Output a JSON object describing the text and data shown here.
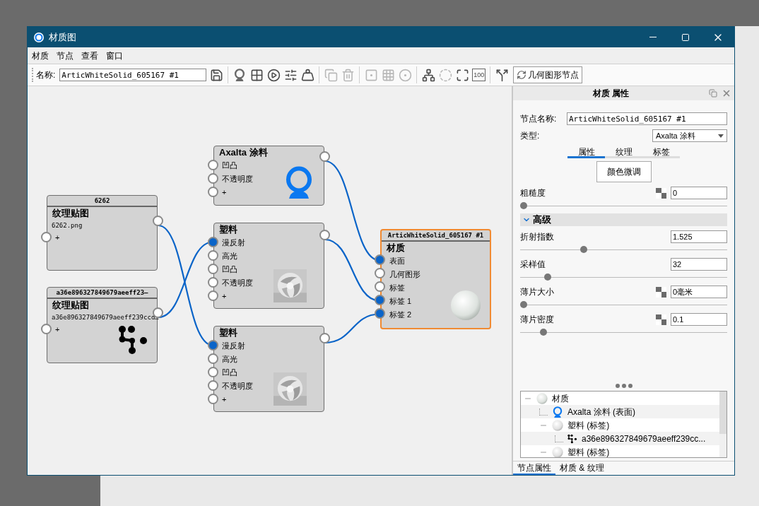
{
  "window": {
    "title": "材质图"
  },
  "menu": [
    "材质",
    "节点",
    "查看",
    "窗口"
  ],
  "toolbar": {
    "name_label": "名称:",
    "name_value": "ArticWhiteSolid_605167 #1",
    "tools": [
      {
        "kind": "save",
        "disabled": false
      },
      {
        "kind": "ring",
        "disabled": false
      },
      {
        "kind": "checker",
        "disabled": false
      },
      {
        "kind": "play",
        "disabled": false
      },
      {
        "kind": "sliders",
        "disabled": false
      },
      {
        "kind": "weight",
        "disabled": false
      },
      {
        "kind": "copy",
        "disabled": true
      },
      {
        "kind": "trash",
        "disabled": true
      },
      {
        "kind": "square-dot",
        "disabled": true
      },
      {
        "kind": "grid-dot",
        "disabled": true
      },
      {
        "kind": "dots-dot",
        "disabled": true
      },
      {
        "kind": "hierarchy",
        "disabled": false
      },
      {
        "kind": "dashed",
        "disabled": true
      },
      {
        "kind": "fit",
        "disabled": false
      },
      {
        "kind": "hundred",
        "label": "100",
        "disabled": false
      },
      {
        "kind": "merge",
        "disabled": false
      }
    ],
    "geometry_button": "几何图形节点"
  },
  "nodes": [
    {
      "header": "6262",
      "title": "纹理贴图",
      "subtitle": "6262.png",
      "output": true,
      "selected": false,
      "ports": [
        {
          "label": "+",
          "connected": false
        }
      ]
    },
    {
      "header": "a36e896327849679aeeff23—",
      "title": "纹理贴图",
      "subtitle": "a36e896327849679aeeff239ccd…",
      "output": true,
      "selected": false,
      "ports": [
        {
          "label": "+",
          "connected": false
        }
      ]
    },
    {
      "title": "Axalta 涂料",
      "output": true,
      "selected": false,
      "ports": [
        {
          "label": "凹凸",
          "connected": false
        },
        {
          "label": "不透明度",
          "connected": false
        },
        {
          "label": "+",
          "connected": false
        }
      ]
    },
    {
      "title": "塑料",
      "output": true,
      "selected": false,
      "ports": [
        {
          "label": "漫反射",
          "connected": true
        },
        {
          "label": "高光",
          "connected": false
        },
        {
          "label": "凹凸",
          "connected": false
        },
        {
          "label": "不透明度",
          "connected": false
        },
        {
          "label": "+",
          "connected": false
        }
      ]
    },
    {
      "title": "塑料",
      "output": true,
      "selected": false,
      "ports": [
        {
          "label": "漫反射",
          "connected": true
        },
        {
          "label": "高光",
          "connected": false
        },
        {
          "label": "凹凸",
          "connected": false
        },
        {
          "label": "不透明度",
          "connected": false
        },
        {
          "label": "+",
          "connected": false
        }
      ]
    },
    {
      "header": "ArticWhiteSolid_605167 #1",
      "title": "材质",
      "output": false,
      "selected": true,
      "ports": [
        {
          "label": "表面",
          "connected": true
        },
        {
          "label": "几何图形",
          "connected": false
        },
        {
          "label": "标签",
          "connected": false
        },
        {
          "label": "标签 1",
          "connected": true
        },
        {
          "label": "标签 2",
          "connected": true
        }
      ]
    }
  ],
  "panel": {
    "title": "材质 属性",
    "node_name_label": "节点名称:",
    "node_name": "ArticWhiteSolid_605167 #1",
    "type_label": "类型:",
    "type_value": "Axalta 涂料",
    "tabs": [
      {
        "label": "属性",
        "selected": true
      },
      {
        "label": "纹理",
        "selected": false
      },
      {
        "label": "标签",
        "selected": false
      }
    ],
    "tune_button": "颜色微调",
    "properties": [
      {
        "kind": "slider",
        "label": "粗糙度",
        "value": "0",
        "texture": true,
        "level": 0
      },
      {
        "kind": "section",
        "label": "高级",
        "expanded": true
      },
      {
        "kind": "slider",
        "label": "折射指数",
        "value": "1.525",
        "texture": false,
        "level": 0.3
      },
      {
        "kind": "slider",
        "label": "采样值",
        "value": "32",
        "texture": false,
        "level": 0.12
      },
      {
        "kind": "slider",
        "label": "薄片大小",
        "value": "0毫米",
        "texture": true,
        "level": 0
      },
      {
        "kind": "slider",
        "label": "薄片密度",
        "value": "0.1",
        "texture": true,
        "level": 0.1
      }
    ],
    "tree": [
      {
        "label": "材质",
        "kind": "material",
        "expanded": true,
        "children": [
          {
            "label": "Axalta 涂料 (表面)",
            "kind": "paint",
            "expanded": false
          },
          {
            "label": "塑料 (标签)",
            "kind": "plastic",
            "expanded": true,
            "children": [
              {
                "label": "a36e896327849679aeeff239cc...",
                "kind": "texture",
                "expanded": false
              }
            ]
          },
          {
            "label": "塑料 (标签)",
            "kind": "plastic",
            "expanded": true
          }
        ]
      }
    ],
    "bottom_tabs": [
      {
        "label": "节点属性",
        "selected": true
      },
      {
        "label": "材质 & 纹理",
        "selected": false
      }
    ]
  }
}
